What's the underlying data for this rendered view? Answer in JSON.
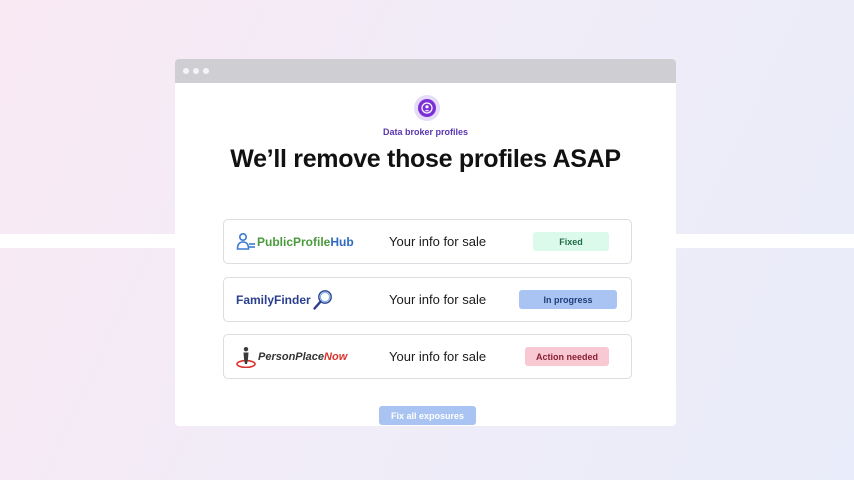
{
  "header": {
    "subtitle": "Data broker profiles",
    "headline": "We’ll remove those profiles ASAP"
  },
  "rows": [
    {
      "broker_part1": "PublicProfile",
      "broker_part2": "Hub",
      "text": "Your info for sale",
      "status": "Fixed",
      "status_bg": "#dcfaeb",
      "status_color": "#1f6b47",
      "logo_icon": "person-list-icon"
    },
    {
      "broker_part1": "FamilyFinder",
      "broker_part2": "",
      "text": "Your info for sale",
      "status": "In progress",
      "status_bg": "#a9c4f2",
      "status_color": "#1f3e7a",
      "logo_icon": "magnifier-icon"
    },
    {
      "broker_part1": "PersonPlace",
      "broker_part2": "Now",
      "text": "Your info for sale",
      "status": "Action needed",
      "status_bg": "#f8c9d2",
      "status_color": "#8a1f34",
      "logo_icon": "person-pin-icon"
    }
  ],
  "actions": {
    "fix_all_label": "Fix all exposures"
  },
  "colors": {
    "accent_purple": "#7b2fd8",
    "fixed": "#dcfaeb",
    "in_progress": "#a9c4f2",
    "action_needed": "#f8c9d2"
  }
}
